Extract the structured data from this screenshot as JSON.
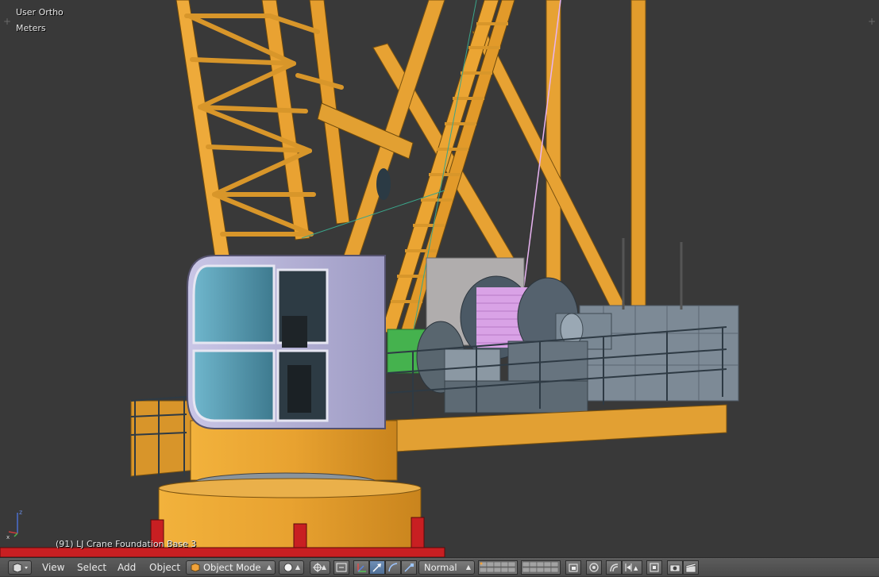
{
  "viewport": {
    "view_name": "User Ortho",
    "units": "Meters",
    "object_info": "(91) LJ Crane Foundation Base 3"
  },
  "header": {
    "editor_type_icon": "3d-view-cube-icon",
    "menus": [
      "View",
      "Select",
      "Add",
      "Object"
    ],
    "mode": {
      "label": "Object Mode",
      "icon": "object-cube-icon"
    },
    "shading_icon": "solid-sphere-icon",
    "pivot_icon": "pivot-point-icon",
    "transform_orientation": "Normal",
    "colors": {
      "header_bg": "#4f4f4f",
      "active_button": "#5680c2",
      "viewport_bg": "#393939"
    }
  }
}
